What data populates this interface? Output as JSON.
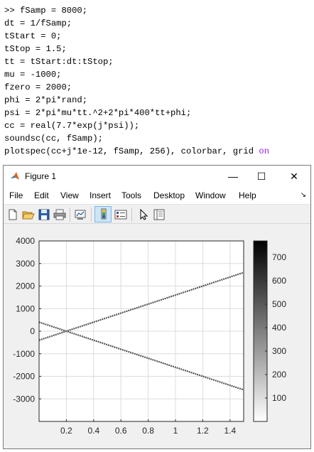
{
  "command_window": {
    "lines": [
      ">> fSamp = 8000;",
      "dt = 1/fSamp;",
      "tStart = 0;",
      "tStop = 1.5;",
      "tt = tStart:dt:tStop;",
      "mu = -1000;",
      "fzero = 2000;",
      "phi = 2*pi*rand;",
      "psi = 2*pi*mu*tt.^2+2*pi*400*tt+phi;",
      "cc = real(7.7*exp(j*psi));",
      "soundsc(cc, fSamp);",
      "plotspec(cc+j*1e-12, fSamp, 256), colorbar, grid "
    ],
    "last_line_keyword": "on"
  },
  "figure_window": {
    "title": "Figure 1",
    "controls": {
      "minimize": "—",
      "maximize": "☐",
      "close": "✕"
    },
    "menus": [
      "File",
      "Edit",
      "View",
      "Insert",
      "Tools",
      "Desktop",
      "Window",
      "Help"
    ],
    "dock_arrow": "↘",
    "toolbar_icons": [
      "new-figure-icon",
      "open-file-icon",
      "save-icon",
      "print-icon",
      "link-plot-icon",
      "insert-colorbar-icon",
      "insert-legend-icon",
      "pointer-icon",
      "property-inspector-icon"
    ]
  },
  "chart_data": {
    "type": "heatmap",
    "title": "",
    "xlabel": "",
    "ylabel": "",
    "xlim": [
      0,
      1.5
    ],
    "ylim": [
      -4000,
      4000
    ],
    "x_ticks": [
      0.2,
      0.4,
      0.6,
      0.8,
      1,
      1.2,
      1.4
    ],
    "x_tick_labels": [
      "0.2",
      "0.4",
      "0.6",
      "0.8",
      "1",
      "1.2",
      "1.4"
    ],
    "y_ticks": [
      4000,
      3000,
      2000,
      1000,
      0,
      -1000,
      -2000,
      -3000
    ],
    "y_tick_labels": [
      "4000",
      "3000",
      "2000",
      "1000",
      "0",
      "-1000",
      "-2000",
      "-3000"
    ],
    "grid": true,
    "series": [
      {
        "x": [
          0,
          1.5
        ],
        "y": [
          -400,
          2600
        ]
      },
      {
        "x": [
          0,
          1.5
        ],
        "y": [
          400,
          -2600
        ]
      }
    ],
    "colorbar": {
      "range": [
        0,
        770
      ],
      "ticks": [
        100,
        200,
        300,
        400,
        500,
        600,
        700
      ],
      "tick_labels": [
        "100",
        "200",
        "300",
        "400",
        "500",
        "600",
        "700"
      ],
      "colormap": "gray-reversed",
      "color_low": "#ffffff",
      "color_high": "#000000"
    },
    "line_color": "#555555"
  }
}
